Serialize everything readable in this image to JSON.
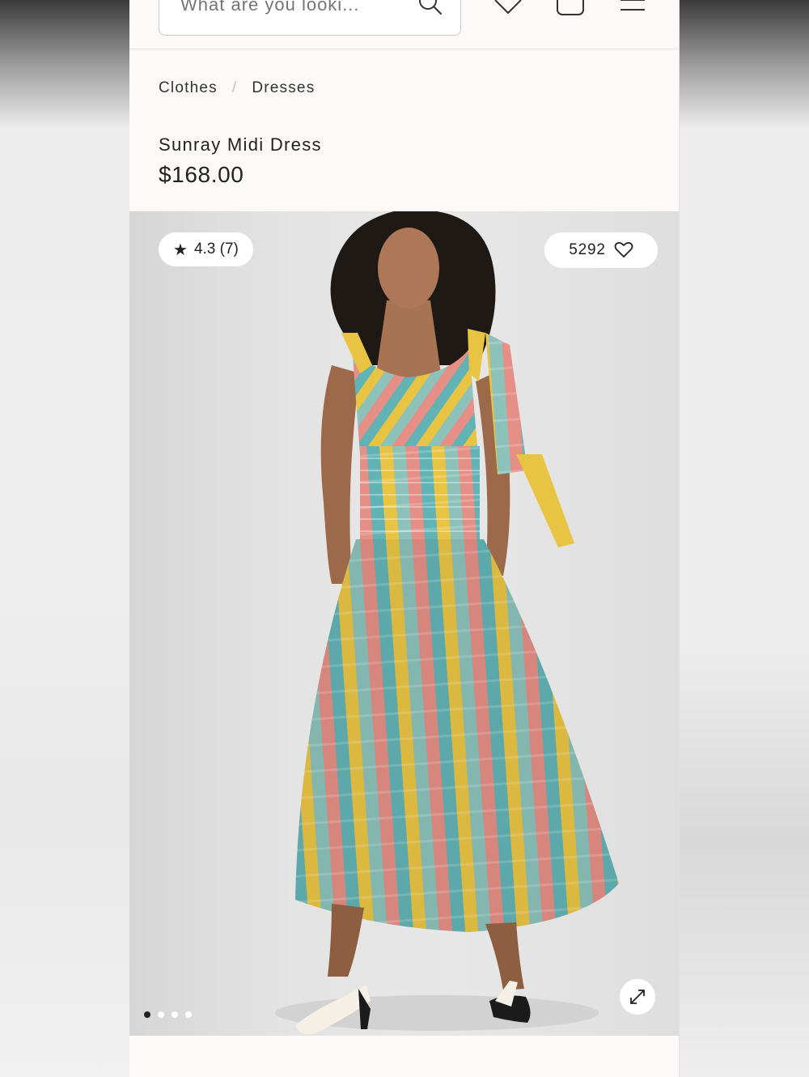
{
  "search": {
    "placeholder": "What are you looki..."
  },
  "header_icons": [
    "search-icon",
    "heart-icon",
    "bag-icon",
    "menu-icon"
  ],
  "breadcrumb": {
    "items": [
      "Clothes",
      "Dresses"
    ],
    "separator": "/"
  },
  "product": {
    "title": "Sunray Midi Dress",
    "price": "$168.00"
  },
  "gallery": {
    "rating": "4.3 (7)",
    "likes": "5292",
    "slide_count": 4,
    "active_slide": 0,
    "dress_colors": [
      "#e58f86",
      "#e9c443",
      "#62b3b5",
      "#c98b8d"
    ]
  },
  "colors": {
    "page_bg": "#fcf9f8",
    "text": "#222222",
    "pill_bg": "#ffffff"
  }
}
